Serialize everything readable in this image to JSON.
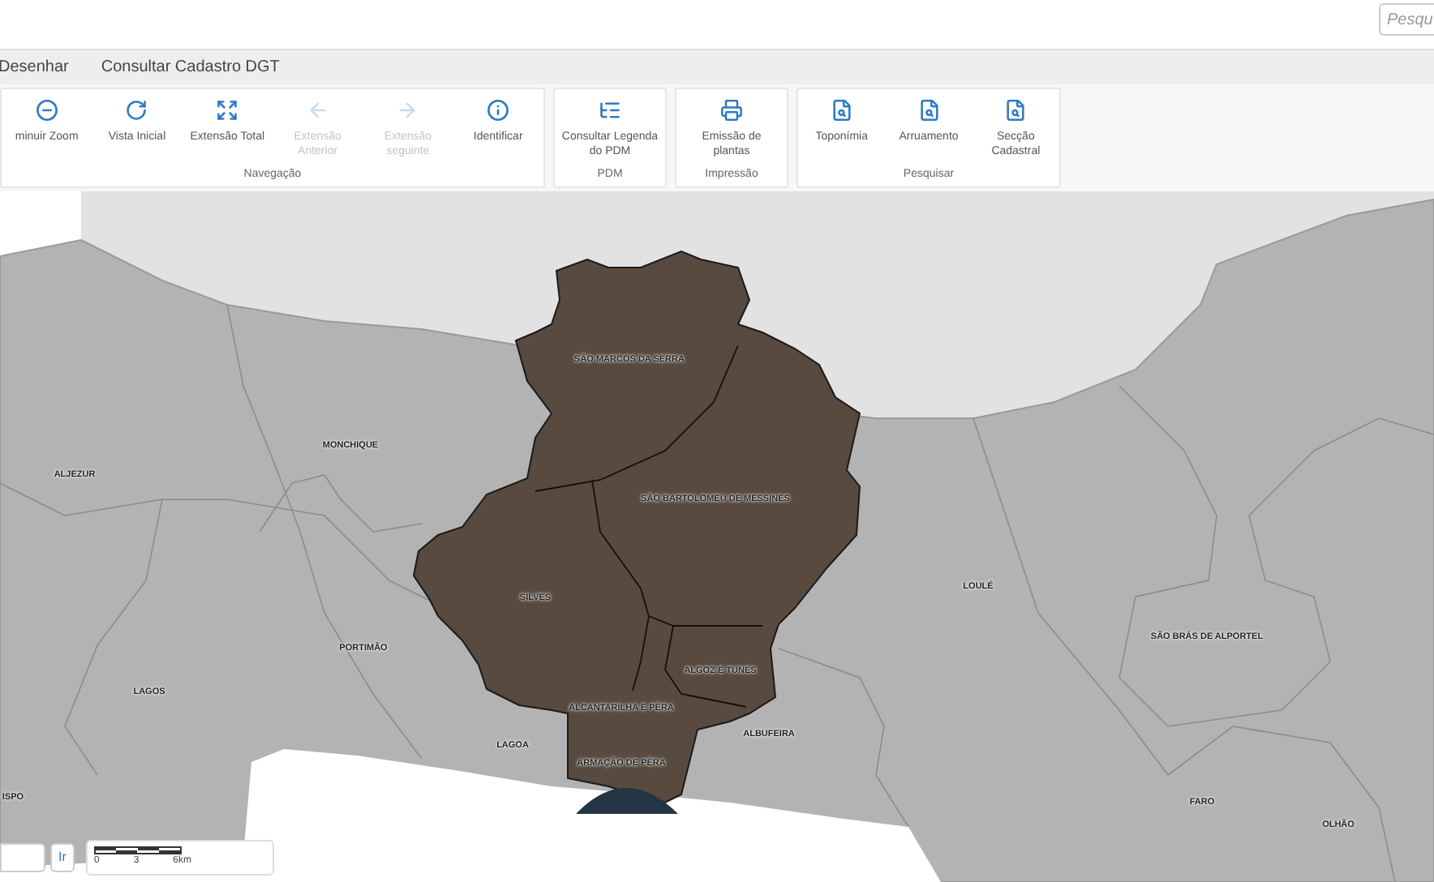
{
  "search": {
    "placeholder": "Pesqu"
  },
  "tabs": [
    {
      "label": "Desenhar"
    },
    {
      "label": "Consultar Cadastro DGT"
    }
  ],
  "ribbon": {
    "groups": [
      {
        "title": "Navegação",
        "buttons": [
          {
            "label": "minuir Zoom",
            "disabled": false
          },
          {
            "label": "Vista Inicial",
            "disabled": false
          },
          {
            "label": "Extensão Total",
            "disabled": false
          },
          {
            "label": "Extensão Anterior",
            "disabled": true
          },
          {
            "label": "Extensão seguinte",
            "disabled": true
          },
          {
            "label": "Identificar",
            "disabled": false
          }
        ]
      },
      {
        "title": "PDM",
        "buttons": [
          {
            "label": "Consultar Legenda do PDM",
            "disabled": false
          }
        ]
      },
      {
        "title": "Impressão",
        "buttons": [
          {
            "label": "Emissão de plantas",
            "disabled": false
          }
        ]
      },
      {
        "title": "Pesquisar",
        "buttons": [
          {
            "label": "Toponímia",
            "disabled": false
          },
          {
            "label": "Arruamento",
            "disabled": false
          },
          {
            "label": "Secção Cadastral",
            "disabled": false
          }
        ]
      }
    ]
  },
  "map": {
    "labels": [
      "SÃO MARCOS DA SERRA",
      "SÃO BARTOLOMEU DE MESSINES",
      "MONCHIQUE",
      "ALJEZUR",
      "SILVES",
      "LOULÉ",
      "SÃO BRÁS DE ALPORTEL",
      "PORTIMÃO",
      "LAGOS",
      "ALGOZ E TUNES",
      "ALCANTARILHA E PÊRA",
      "ALBUFEIRA",
      "LAGOA",
      "ARMAÇÃO DE PÊRA",
      "ISPO",
      "FARO",
      "OLHÃO"
    ]
  },
  "go_button": "Ir",
  "scale_bar": {
    "ticks": [
      "0",
      "3",
      "6km"
    ]
  }
}
